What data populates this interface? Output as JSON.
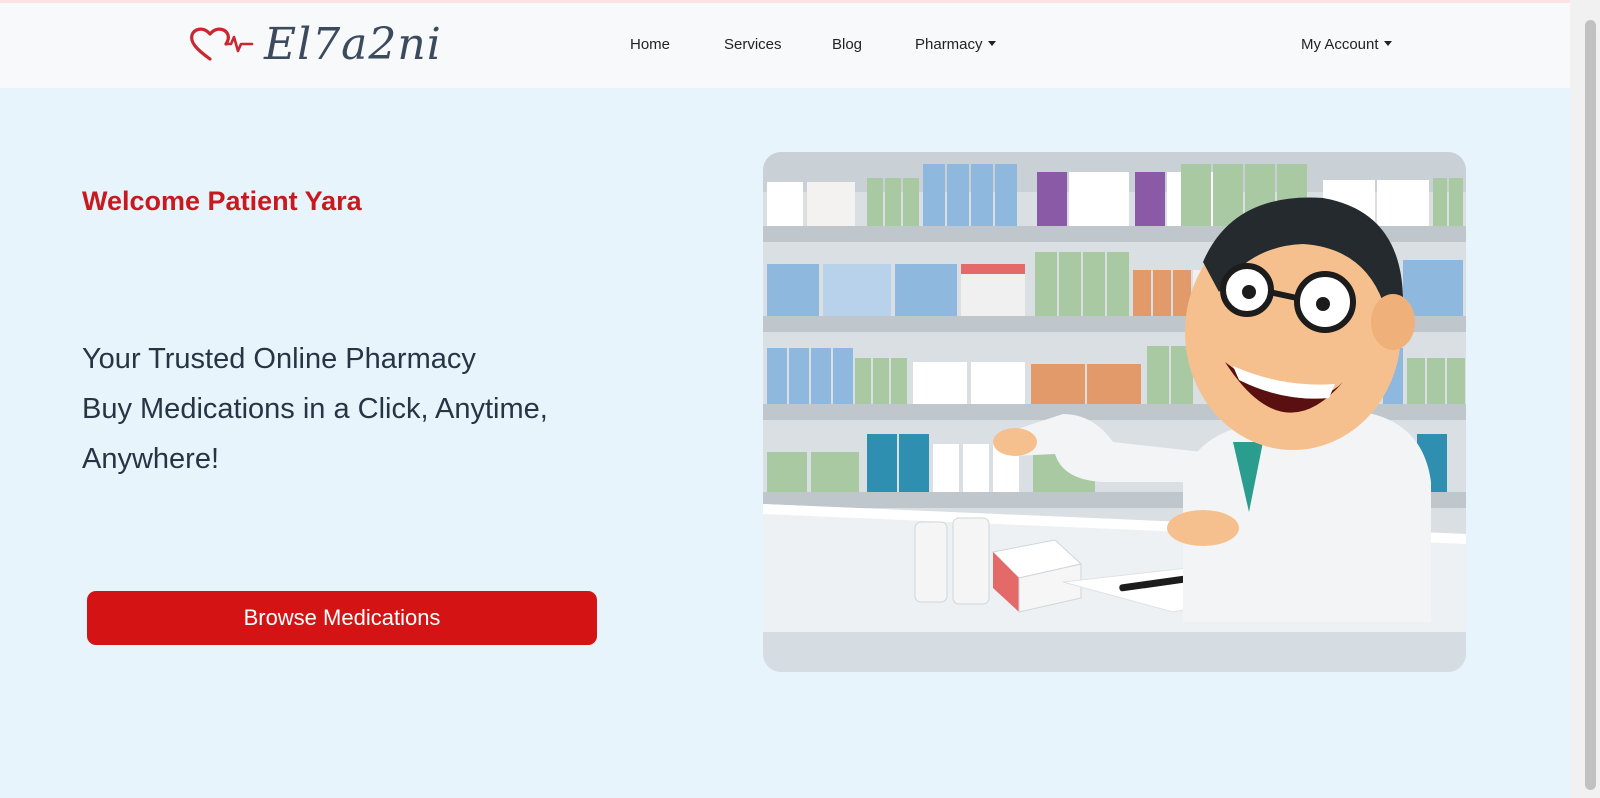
{
  "brand": {
    "name": "El7a2ni"
  },
  "nav": {
    "home": "Home",
    "services": "Services",
    "blog": "Blog",
    "pharmacy": "Pharmacy",
    "account": "My Account"
  },
  "hero": {
    "welcome": "Welcome Patient Yara",
    "tagline_lines": [
      "Your Trusted Online Pharmacy",
      "Buy Medications in a Click, Anytime,",
      "Anywhere!"
    ],
    "cta": "Browse Medications",
    "image": "pharmacist-illustration"
  },
  "colors": {
    "accent_red": "#c81a1e",
    "button_red": "#d41315",
    "page_background": "#e8f4fb",
    "navbar_background": "#f8f9fb"
  }
}
